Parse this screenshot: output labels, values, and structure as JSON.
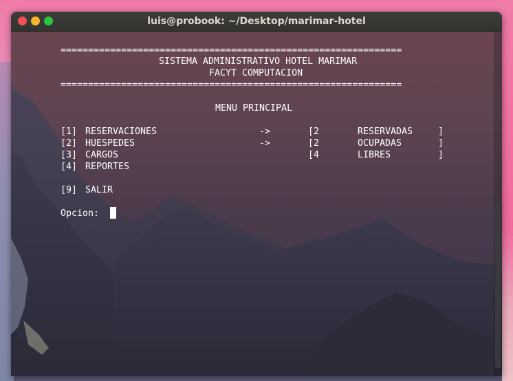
{
  "window": {
    "title": "luis@probook: ~/Desktop/marimar-hotel"
  },
  "terminal": {
    "rule": "==============================================================",
    "system_title": "SISTEMA ADMINISTRATIVO HOTEL MARIMAR",
    "subtitle": "FACYT COMPUTACION",
    "menu_heading": "MENU PRINCIPAL",
    "menu_items": [
      {
        "key": "[1]",
        "label": "RESERVACIONES"
      },
      {
        "key": "[2]",
        "label": "HUESPEDES"
      },
      {
        "key": "[3]",
        "label": "CARGOS"
      },
      {
        "key": "[4]",
        "label": "REPORTES"
      }
    ],
    "exit_item": {
      "key": "[9]",
      "label": "SALIR"
    },
    "arrow": "->",
    "status": [
      {
        "open": "[2",
        "label": "RESERVADAS",
        "close": "]"
      },
      {
        "open": "[2",
        "label": "OCUPADAS",
        "close": "]"
      },
      {
        "open": "[4",
        "label": "LIBRES",
        "close": "]"
      }
    ],
    "prompt": "Opcion:"
  },
  "colors": {
    "terminal_text": "#ffffff",
    "close": "#f25056",
    "minimize": "#f8b62c",
    "maximize": "#2bc540"
  }
}
